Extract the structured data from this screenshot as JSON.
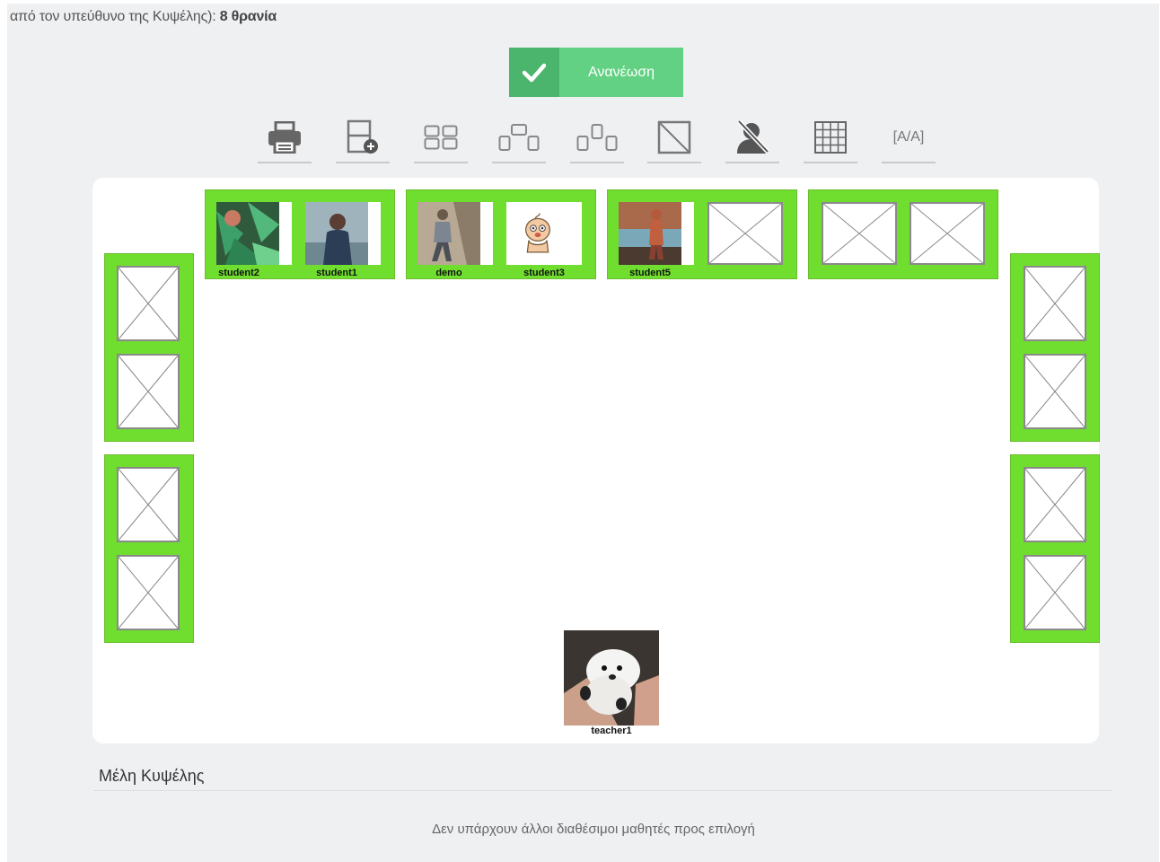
{
  "header": {
    "info_prefix": "από τον υπεύθυνο της Κυψέλης):",
    "info_value": "8 θρανία"
  },
  "refresh_button": {
    "label": "Ανανέωση",
    "icon": "check-icon"
  },
  "toolbar": {
    "items": [
      {
        "icon": "print-icon"
      },
      {
        "icon": "add-desk-icon"
      },
      {
        "icon": "grid-layout-icon"
      },
      {
        "icon": "group-layout-icon"
      },
      {
        "icon": "group-layout-alt-icon"
      },
      {
        "icon": "empty-seat-icon"
      },
      {
        "icon": "remove-user-icon"
      },
      {
        "icon": "grid-icon"
      },
      {
        "label": "[A/A]"
      }
    ]
  },
  "classroom": {
    "top_desks": [
      {
        "seats": [
          {
            "name": "student2",
            "avatar": "leaves"
          },
          {
            "name": "student1",
            "avatar": "person-coast"
          }
        ]
      },
      {
        "seats": [
          {
            "name": "demo",
            "avatar": "walker"
          },
          {
            "name": "student3",
            "avatar": "baby-cartoon"
          }
        ]
      },
      {
        "seats": [
          {
            "name": "student5",
            "avatar": "dog-pier"
          },
          {
            "name": "",
            "avatar": "empty"
          }
        ]
      },
      {
        "seats": [
          {
            "name": "",
            "avatar": "empty"
          },
          {
            "name": "",
            "avatar": "empty"
          }
        ]
      }
    ],
    "teacher": {
      "name": "teacher1",
      "avatar": "puppy"
    }
  },
  "members": {
    "title": "Μέλη Κυψέλης",
    "empty_message": "Δεν υπάρχουν άλλοι διαθέσιμοι μαθητές προς επιλογή"
  },
  "colors": {
    "desk": "#70de2e",
    "button_dark": "#4cb56d",
    "button_light": "#63d183",
    "background": "#eff0f2"
  }
}
